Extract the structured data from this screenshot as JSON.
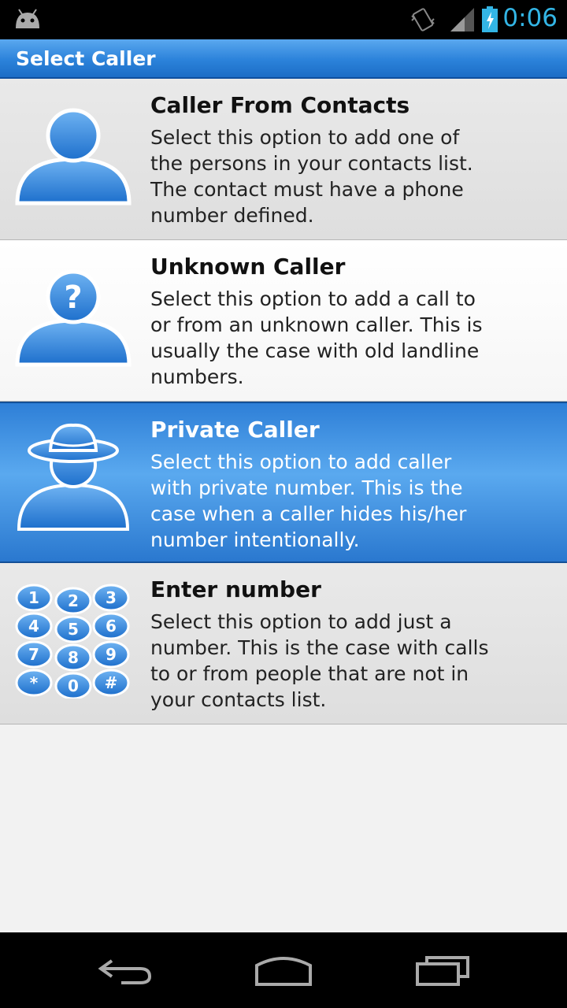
{
  "status_bar": {
    "time": "0:06",
    "icons": [
      "android-icon",
      "vibrate-icon",
      "signal-icon",
      "battery-icon"
    ],
    "clock_color": "#33b5e5"
  },
  "title_bar": {
    "title": "Select Caller"
  },
  "options": [
    {
      "title": "Caller From Contacts",
      "description": "Select this option to add one of the persons in your contacts list. The contact must have a phone number defined.",
      "icon": "contact-person-icon"
    },
    {
      "title": "Unknown Caller",
      "description": "Select this option to add a call to or from an unknown caller. This is usually the case with old landline numbers.",
      "icon": "unknown-person-icon"
    },
    {
      "title": "Private Caller",
      "description": "Select this option to add caller with private number. This is the case when a caller hides his/her number intentionally.",
      "icon": "private-person-hat-icon",
      "selected": true
    },
    {
      "title": "Enter number",
      "description": "Select this option to add just a number. This is the case with calls to or from people that are not in your contacts list.",
      "icon": "keypad-icon",
      "keys": [
        "1",
        "2",
        "3",
        "4",
        "5",
        "6",
        "7",
        "8",
        "9",
        "*",
        "0",
        "#"
      ]
    }
  ],
  "nav_bar": {
    "buttons": [
      "back-icon",
      "home-icon",
      "recent-apps-icon"
    ]
  },
  "colors": {
    "accent_blue": "#2b82da",
    "selected_blue": "#3a8de0"
  }
}
